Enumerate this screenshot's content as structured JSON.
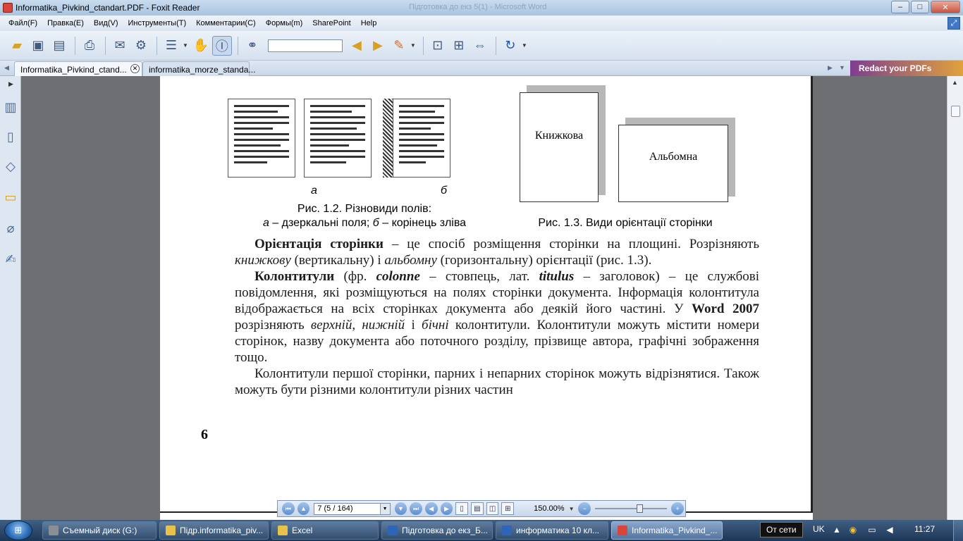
{
  "window": {
    "title": "Informatika_Pivkind_ctandart.PDF - Foxit Reader",
    "ghost_title": "Підготовка до екз 5(1) - Microsoft Word",
    "minimize": "–",
    "maximize": "□",
    "close": "✕"
  },
  "menu": {
    "items": [
      "Файл(F)",
      "Правка(E)",
      "Вид(V)",
      "Инструменты(T)",
      "Комментарии(C)",
      "Формы(m)",
      "SharePoint",
      "Help"
    ]
  },
  "toolbar": {
    "search_value": ""
  },
  "tabs": {
    "items": [
      "Informatika_Pivkind_ctand...",
      "informatika_morze_standa..."
    ],
    "close": "✕",
    "redact": "Redact your PDFs"
  },
  "document": {
    "fig12": {
      "label_a": "а",
      "label_b": "б",
      "caption_line1": "Рис. 1.2. Різновиди полів:",
      "caption_line2_a": "а",
      "caption_line2_mid": " – дзеркальні поля; ",
      "caption_line2_b": "б",
      "caption_line2_end": " – корінець зліва"
    },
    "fig13": {
      "portrait": "Книжкова",
      "landscape": "Альбомна",
      "caption": "Рис. 1.3. Види орієнтації сторінки"
    },
    "p1": {
      "term": "Орієнтація сторінки",
      "t1": " – це спосіб розміщення сторінки на площині. Розрізняють ",
      "i1": "книжкову",
      "t2": " (вертикальну) і ",
      "i2": "альбомну",
      "t3": " (горизонтальну) орієнтації (рис. 1.3)."
    },
    "p2": {
      "term": "Колонтитули",
      "t1": " (фр. ",
      "w1": "colonne",
      "t2": " – стовпець, лат. ",
      "w2": "titulus",
      "t3": " – заголовок) – це службові повідомлення, які розміщуються на полях сторінки документа. Інформація колонтитула відображається на всіх сторінках документа або деякій його частині. У ",
      "word": "Word 2007",
      "t4": " розрізняють ",
      "i1": "верхній",
      "t5": ", ",
      "i2": "нижній",
      "t6": " і ",
      "i3": "бічні",
      "t7": " колонтитули. Колонтитули можуть містити номери сторінок, назву документа або поточного розділу, прізвище автора, графічні зображення тощо."
    },
    "p3": "Колонтитули першої сторінки, парних і непарних сторінок можуть відрізнятися. Також можуть бути різними колонтитули різних частин",
    "page_number": "6"
  },
  "navbar": {
    "page_value": "7 (5 / 164)",
    "zoom": "150.00%",
    "zoom_level": 0.62
  },
  "taskbar": {
    "items": [
      {
        "label": "Съемный диск (G:)",
        "color": "#8a8f96"
      },
      {
        "label": "Підр.informatika_piv...",
        "color": "#e7c24a"
      },
      {
        "label": "Excel",
        "color": "#e7c24a"
      },
      {
        "label": "Підготовка до екз_Б...",
        "color": "#2f64b8"
      },
      {
        "label": "информатика 10 кл...",
        "color": "#2f64b8"
      },
      {
        "label": "Informatika_Pivkind_...",
        "color": "#d8453d"
      }
    ],
    "tooltip": "От сети",
    "lang": "UK",
    "clock": "11:27"
  },
  "colors": {
    "accent": "#3f78c4",
    "redact_start": "#7d3e8f",
    "redact_end": "#e0a13d"
  }
}
